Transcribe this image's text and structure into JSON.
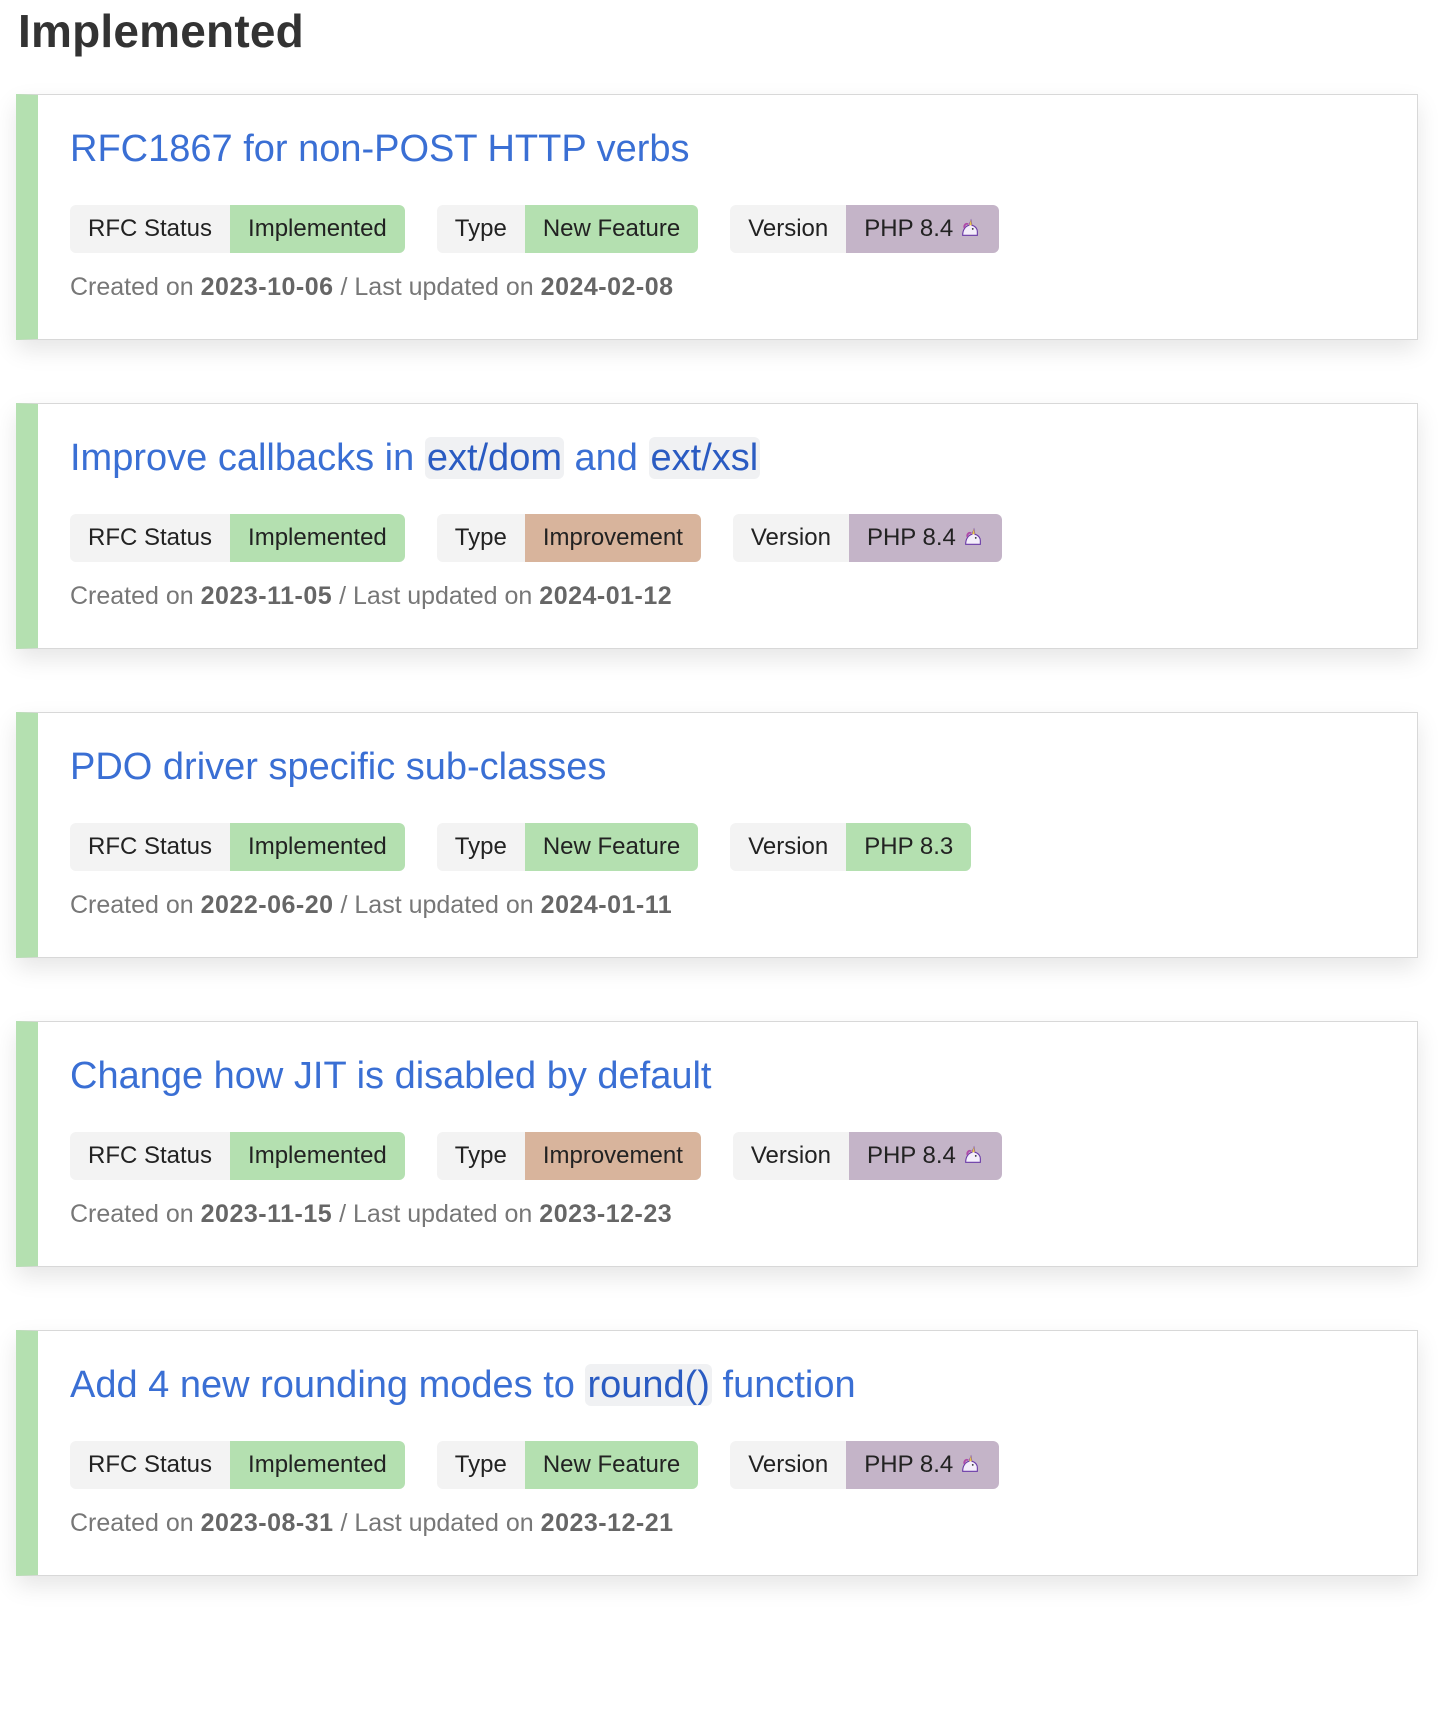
{
  "section": {
    "title": "Implemented"
  },
  "cards": [
    {
      "title_parts": [
        "RFC1867 for non-POST HTTP verbs"
      ],
      "status_key": "RFC Status",
      "status_val": "Implemented",
      "type_key": "Type",
      "type_val": "New Feature",
      "version_key": "Version",
      "version_val": "PHP 8.4",
      "created_label": "Created on",
      "created": "2023-10-06",
      "updated_label": "/ Last updated on",
      "updated": "2024-02-08"
    },
    {
      "title_parts": [
        "Improve callbacks in ",
        "ext/dom",
        " and ",
        "ext/xsl"
      ],
      "status_key": "RFC Status",
      "status_val": "Implemented",
      "type_key": "Type",
      "type_val": "Improvement",
      "version_key": "Version",
      "version_val": "PHP 8.4",
      "created_label": "Created on",
      "created": "2023-11-05",
      "updated_label": "/ Last updated on",
      "updated": "2024-01-12"
    },
    {
      "title_parts": [
        "PDO driver specific sub-classes"
      ],
      "status_key": "RFC Status",
      "status_val": "Implemented",
      "type_key": "Type",
      "type_val": "New Feature",
      "version_key": "Version",
      "version_val": "PHP 8.3",
      "created_label": "Created on",
      "created": "2022-06-20",
      "updated_label": "/ Last updated on",
      "updated": "2024-01-11"
    },
    {
      "title_parts": [
        "Change how JIT is disabled by default"
      ],
      "status_key": "RFC Status",
      "status_val": "Implemented",
      "type_key": "Type",
      "type_val": "Improvement",
      "version_key": "Version",
      "version_val": "PHP 8.4",
      "created_label": "Created on",
      "created": "2023-11-15",
      "updated_label": "/ Last updated on",
      "updated": "2023-12-23"
    },
    {
      "title_parts": [
        "Add 4 new rounding modes to ",
        "round()",
        " function"
      ],
      "status_key": "RFC Status",
      "status_val": "Implemented",
      "type_key": "Type",
      "type_val": "New Feature",
      "version_key": "Version",
      "version_val": "PHP 8.4",
      "created_label": "Created on",
      "created": "2023-08-31",
      "updated_label": "/ Last updated on",
      "updated": "2023-12-21"
    }
  ],
  "icons": {
    "unicorn": "unicorn-icon"
  },
  "colors": {
    "accent_bar": "#b4e0b0",
    "link": "#3a6fd4",
    "implemented": "#b4e0b0",
    "new_feature": "#b4e0b0",
    "improvement": "#d8b49c",
    "php_84": "#c4b4c8",
    "php_83": "#b4e0b0"
  }
}
